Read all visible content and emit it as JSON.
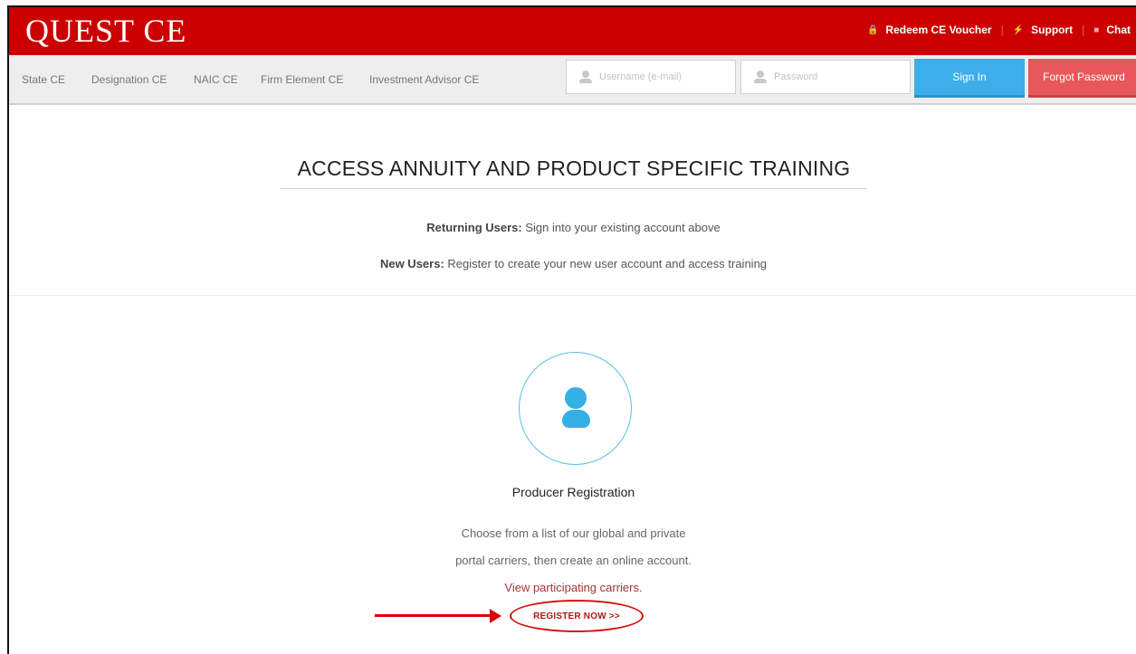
{
  "brand": {
    "logo_text": "QUEST CE",
    "primary_color": "#cc0000"
  },
  "top_links": [
    {
      "label": "Redeem CE Voucher",
      "icon": "lock-icon"
    },
    {
      "label": "Support",
      "icon": "lightning-icon"
    },
    {
      "label": "Chat",
      "icon": "chat-icon"
    }
  ],
  "nav": {
    "items": [
      "State CE",
      "Designation CE",
      "NAIC CE",
      "Firm Element CE",
      "Investment Advisor CE"
    ]
  },
  "login": {
    "username_placeholder": "Username (e-mail)",
    "password_placeholder": "Password",
    "signin_label": "Sign In",
    "forgot_label": "Forgot Password",
    "signin_color": "#3daee9",
    "forgot_color": "#e8585a"
  },
  "main": {
    "heading": "ACCESS ANNUITY AND PRODUCT SPECIFIC TRAINING",
    "returning_label": "Returning Users:",
    "returning_text": " Sign into your existing account above",
    "new_label": "New Users:",
    "new_text": " Register to create your new user account and access training"
  },
  "registration": {
    "icon": "user-icon",
    "title": "Producer Registration",
    "desc_line1": "Choose from a list of our global and private",
    "desc_line2": "portal carriers, then create an online account.",
    "carriers_link": "View participating carriers.",
    "register_label": "REGISTER NOW >>"
  }
}
